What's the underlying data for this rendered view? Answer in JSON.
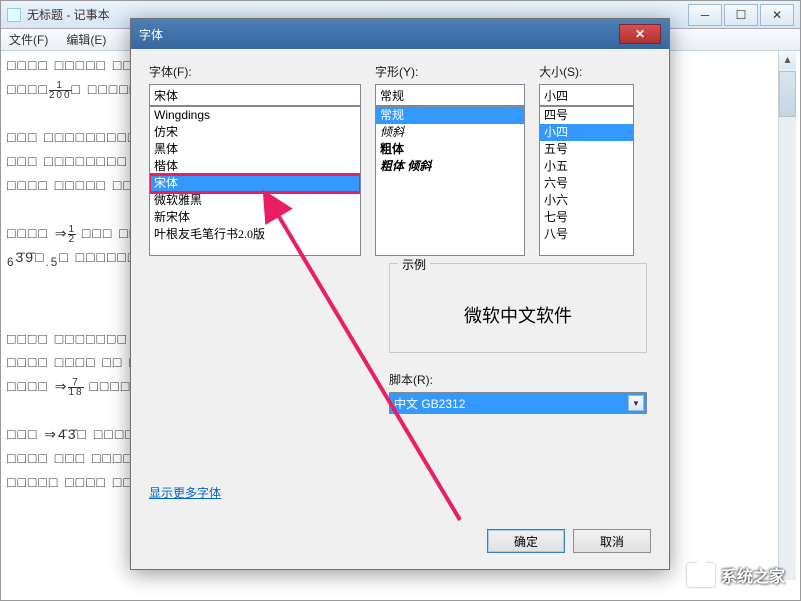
{
  "notepad": {
    "title": "无标题 - 记事本",
    "menu": {
      "file": "文件(F)",
      "edit": "编辑(E)"
    }
  },
  "dialog": {
    "title": "字体",
    "font_label": "字体(F):",
    "font_value": "宋体",
    "font_list": [
      "Wingdings",
      "仿宋",
      "黑体",
      "楷体",
      "宋体",
      "微软雅黑",
      "新宋体",
      "叶根友毛笔行书2.0版"
    ],
    "font_selected": "宋体",
    "style_label": "字形(Y):",
    "style_value": "常规",
    "style_list": [
      "常规",
      "倾斜",
      "粗体",
      "粗体 倾斜"
    ],
    "style_selected": "常规",
    "size_label": "大小(S):",
    "size_value": "小四",
    "size_list": [
      "四号",
      "小四",
      "五号",
      "小五",
      "六号",
      "小六",
      "七号",
      "八号"
    ],
    "size_selected": "小四",
    "sample_label": "示例",
    "sample_text": "微软中文软件",
    "script_label": "脚本(R):",
    "script_value": "中文 GB2312",
    "more_fonts": "显示更多字体",
    "ok": "确定",
    "cancel": "取消"
  },
  "watermark": "系统之家"
}
